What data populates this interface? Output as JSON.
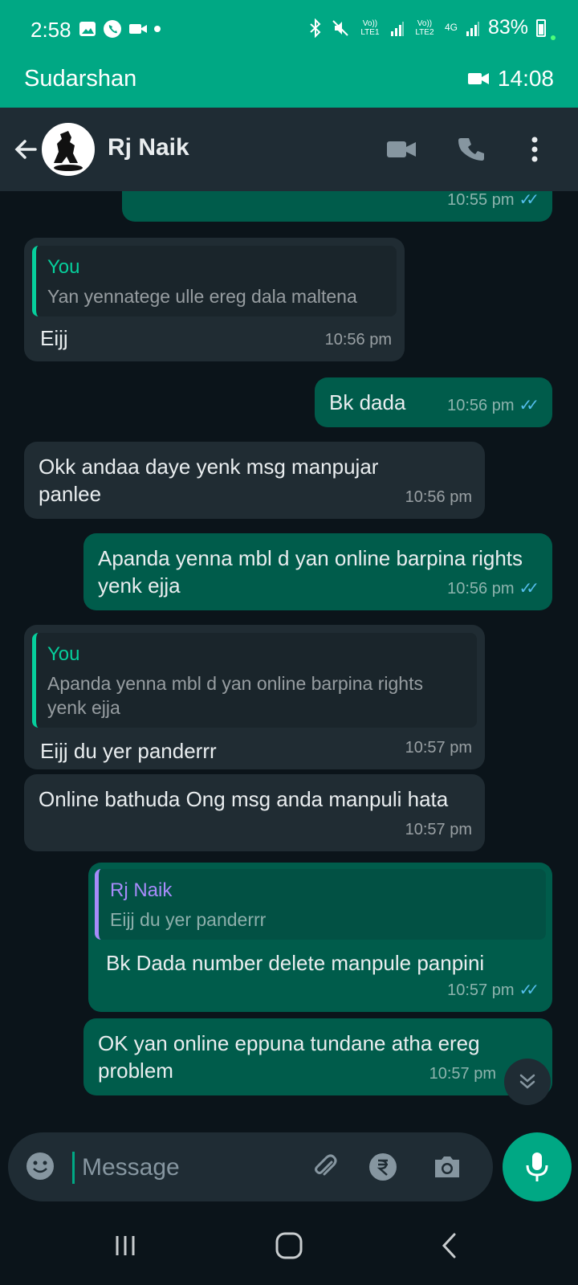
{
  "status_bar": {
    "time": "2:58",
    "battery": "83%",
    "sim1_label": "Vo)) LTE1",
    "sim2_label": "Vo)) LTE2",
    "network": "4G"
  },
  "call_banner": {
    "contact": "Sudarshan",
    "duration": "14:08"
  },
  "header": {
    "title": "Rj Naik"
  },
  "messages": [
    {
      "type": "out",
      "text": "",
      "time": "10:55 pm"
    },
    {
      "type": "in",
      "quote_name": "You",
      "quote_text": "Yan yennatege ulle ereg dala maltena",
      "text": "Eijj",
      "time": "10:56 pm"
    },
    {
      "type": "out",
      "text": "Bk dada",
      "time": "10:56 pm"
    },
    {
      "type": "in",
      "text": "Okk andaa daye yenk msg manpujar panlee",
      "time": "10:56 pm"
    },
    {
      "type": "out",
      "text": "Apanda yenna mbl d yan online barpina rights yenk ejja",
      "time": "10:56 pm"
    },
    {
      "type": "in",
      "quote_name": "You",
      "quote_text": "Apanda yenna mbl d yan online barpina rights yenk ejja",
      "text": "Eijj du yer panderrr",
      "time": "10:57 pm"
    },
    {
      "type": "in",
      "text": "Online bathuda Ong msg anda manpuli hata",
      "time": "10:57 pm"
    },
    {
      "type": "out",
      "quote_name": "Rj Naik",
      "quote_text": "Eijj du yer panderrr",
      "text": "Bk Dada number delete manpule panpini",
      "time": "10:57 pm"
    },
    {
      "type": "out",
      "text": "OK yan online eppuna tundane atha ereg problem",
      "time": "10:57 pm"
    }
  ],
  "input": {
    "placeholder": "Message"
  },
  "colors": {
    "accent": "#00a884",
    "outgoing_bubble": "#005c4b",
    "incoming_bubble": "#202c33",
    "background": "#0b141a",
    "read_ticks": "#53bdeb"
  },
  "icons": [
    "back-arrow-icon",
    "video-call-icon",
    "voice-call-icon",
    "more-options-icon",
    "emoji-icon",
    "attach-icon",
    "rupee-payment-icon",
    "camera-icon",
    "mic-icon",
    "scroll-down-icon",
    "recents-icon",
    "home-icon",
    "nav-back-icon"
  ]
}
